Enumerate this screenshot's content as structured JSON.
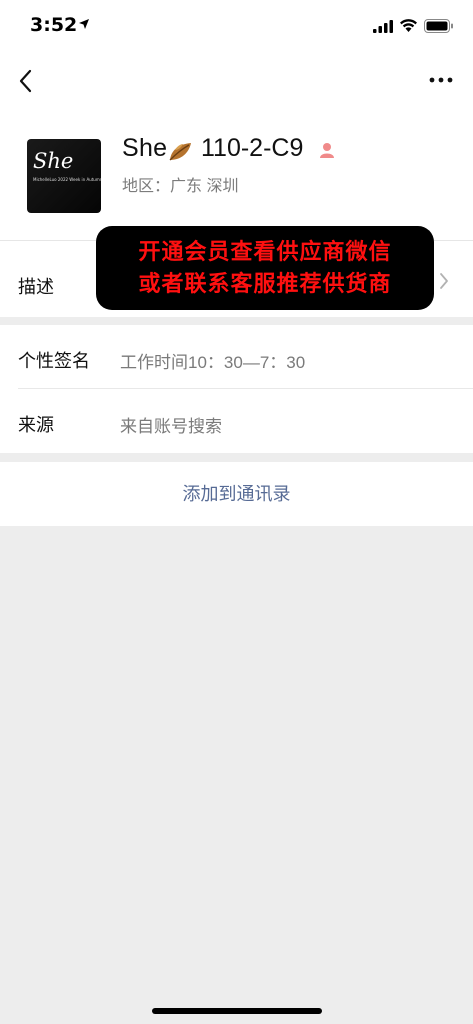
{
  "status": {
    "time": "3:52"
  },
  "profile": {
    "avatar_text": "She",
    "avatar_subtext": "MichelleLuo 2022 Week in Autumn",
    "name_part1": "She",
    "name_part2": "110-2-C9",
    "region": "地区：广东 深圳"
  },
  "rows": {
    "desc_label": "描述",
    "signature_label": "个性签名",
    "signature_value": "工作时间10：30—7：30",
    "source_label": "来源",
    "source_value": "来自账号搜索"
  },
  "actions": {
    "add_contact": "添加到通讯录"
  },
  "banner": {
    "line1": "开通会员查看供应商微信",
    "line2": "或者联系客服推荐供货商"
  },
  "colors": {
    "link": "#576b95",
    "banner_text": "#ff1010",
    "background": "#ededed"
  }
}
